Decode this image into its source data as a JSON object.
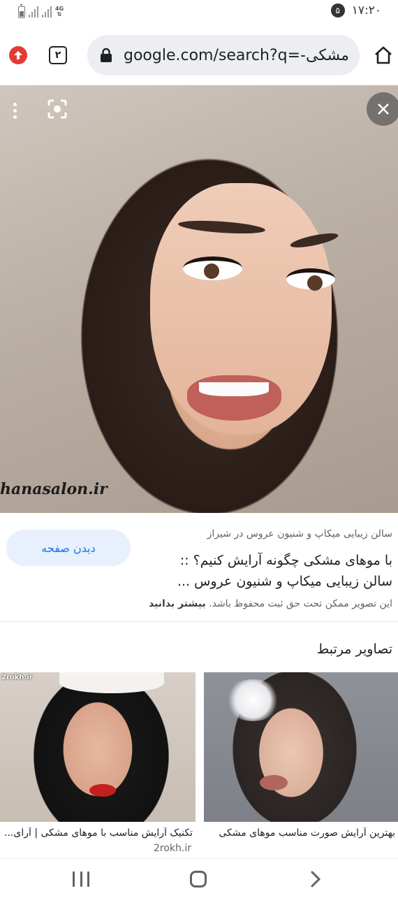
{
  "status_bar": {
    "network": "4G",
    "notification_count": "۵",
    "time": "۱۷:۲۰"
  },
  "browser": {
    "tab_count": "۲",
    "url": "google.com/search?q=-مشکی"
  },
  "image_viewer": {
    "watermark": "hanasalon.ir"
  },
  "result": {
    "visit_button": "دیدن صفحه",
    "source": "سالن زیبایی میکاپ و شنیون عروس در شیراز",
    "title": "با موهای مشکی چگونه آرایش کنیم؟ :: سالن زیبایی میکاپ و شنیون عروس ...",
    "copyright_text": "این تصویر ممکن تحت حق ثبت محفوظ باشد.",
    "learn_more": "بیشتر بدانید"
  },
  "related": {
    "heading": "تصاویر مرتبط",
    "items": [
      {
        "caption": "بهترین آرایش صورت مناسب موهای مشکی",
        "domain": ""
      },
      {
        "caption": "تکنیک آرایش مناسب با موهای مشکی | آرای...",
        "domain": "2rokh.ir",
        "watermark": "2rokh.ir"
      }
    ]
  },
  "colors": {
    "accent": "#1a73e8",
    "visit_button_bg": "#e8f0fe",
    "extension_red": "#e53935"
  }
}
